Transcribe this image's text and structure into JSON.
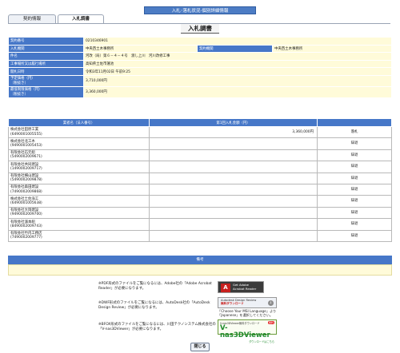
{
  "banner": "入札･落札状況-個別詳細情報",
  "tabs": [
    {
      "label": "契約情報",
      "active": false
    },
    {
      "label": "入札調書",
      "active": true
    }
  ],
  "page_title": "入札調書",
  "info": {
    "contract_no": {
      "label": "契約番号",
      "value": "0210346901"
    },
    "bid_office": {
      "label": "入札機関",
      "value": "中央西土木事務所"
    },
    "contract_office": {
      "label": "契約機関",
      "value": "中央西土木事務所"
    },
    "project_name": {
      "label": "件名",
      "value": "河改（局）第６－４－４号　渡し上川　河川改修工事"
    },
    "location": {
      "label": "工事場所又は履行場所",
      "value": "高知県土佐市蓮池"
    },
    "open_date": {
      "label": "開札日時",
      "value": "令和3年11月02日 午前9:25"
    },
    "planned_price": {
      "label": "予定価格（円）\n（税抜き）",
      "value": "3,710,000円"
    },
    "min_price": {
      "label": "最低制限価格（円）\n（税抜き）",
      "value": "3,360,000円"
    }
  },
  "bids": {
    "headers": [
      "業者名（法人番号）",
      "第1回入札金額（円）",
      ""
    ],
    "rows": [
      {
        "name": "株式会社田原工業",
        "corp_no": "(6490001005555)",
        "amount": "3,360,000円",
        "result": "落札"
      },
      {
        "name": "株式会社北工木",
        "corp_no": "(9490001005453)",
        "amount": "",
        "result": "辞退"
      },
      {
        "name": "有限会社石元組",
        "corp_no": "(5490002009671)",
        "amount": "",
        "result": "辞退"
      },
      {
        "name": "有限会社共同建設",
        "corp_no": "(1490002009717)",
        "amount": "",
        "result": "辞退"
      },
      {
        "name": "有限会社横山建設",
        "corp_no": "(5490002009878)",
        "amount": "",
        "result": "辞退"
      },
      {
        "name": "有限会社森田建設",
        "corp_no": "(7490002009868)",
        "amount": "",
        "result": "辞退"
      },
      {
        "name": "株式会社土佐海工",
        "corp_no": "(6490001005638)",
        "amount": "",
        "result": "辞退"
      },
      {
        "name": "有限会社大岡建設",
        "corp_no": "(9490002009700)",
        "amount": "",
        "result": "辞退"
      },
      {
        "name": "有限会社濱本組",
        "corp_no": "(8490002009743)",
        "amount": "",
        "result": "辞退"
      },
      {
        "name": "有限会社竹内工務店",
        "corp_no": "(7490002009777)",
        "amount": "",
        "result": "辞退"
      }
    ]
  },
  "notes": {
    "label": "備考",
    "value": ""
  },
  "downloads": [
    {
      "text": "※PDF形式のファイルをご覧になるには、Adobe社の「Adobe Acrobat Reader」が必要になります。",
      "logo_title": "Get Adobe",
      "logo_sub": "Acrobat Reader",
      "logo_icon": "acrobat-icon"
    },
    {
      "text": "※DWF形式のファイルをご覧になるには、AutoDesk社の「AutoDesk Design Review」が必要になります。",
      "logo_title": "Autodesk Design Review",
      "logo_sub": "無料ダウンロード",
      "logo_icon": "download-arrow-icon",
      "extra": "「Choose Your MSI Language」より「Japanese」を選択してください。"
    },
    {
      "text": "※BFOX形式のファイルをご覧になるには、川田テクノシステム株式会社の「V-nas3DViewer」が必要になります。",
      "logo_title": "V-nas3DViewer",
      "logo_top": "V-nas3DViewer無料ダウンロード",
      "logo_sub": "ダウンロードはこちら",
      "logo_badge": "無料"
    }
  ],
  "close_button": "閉じる",
  "colors": {
    "header_blue": "#4677c8",
    "value_yellow": "#fffbd9",
    "banner_blue": "#4c7cc4"
  }
}
